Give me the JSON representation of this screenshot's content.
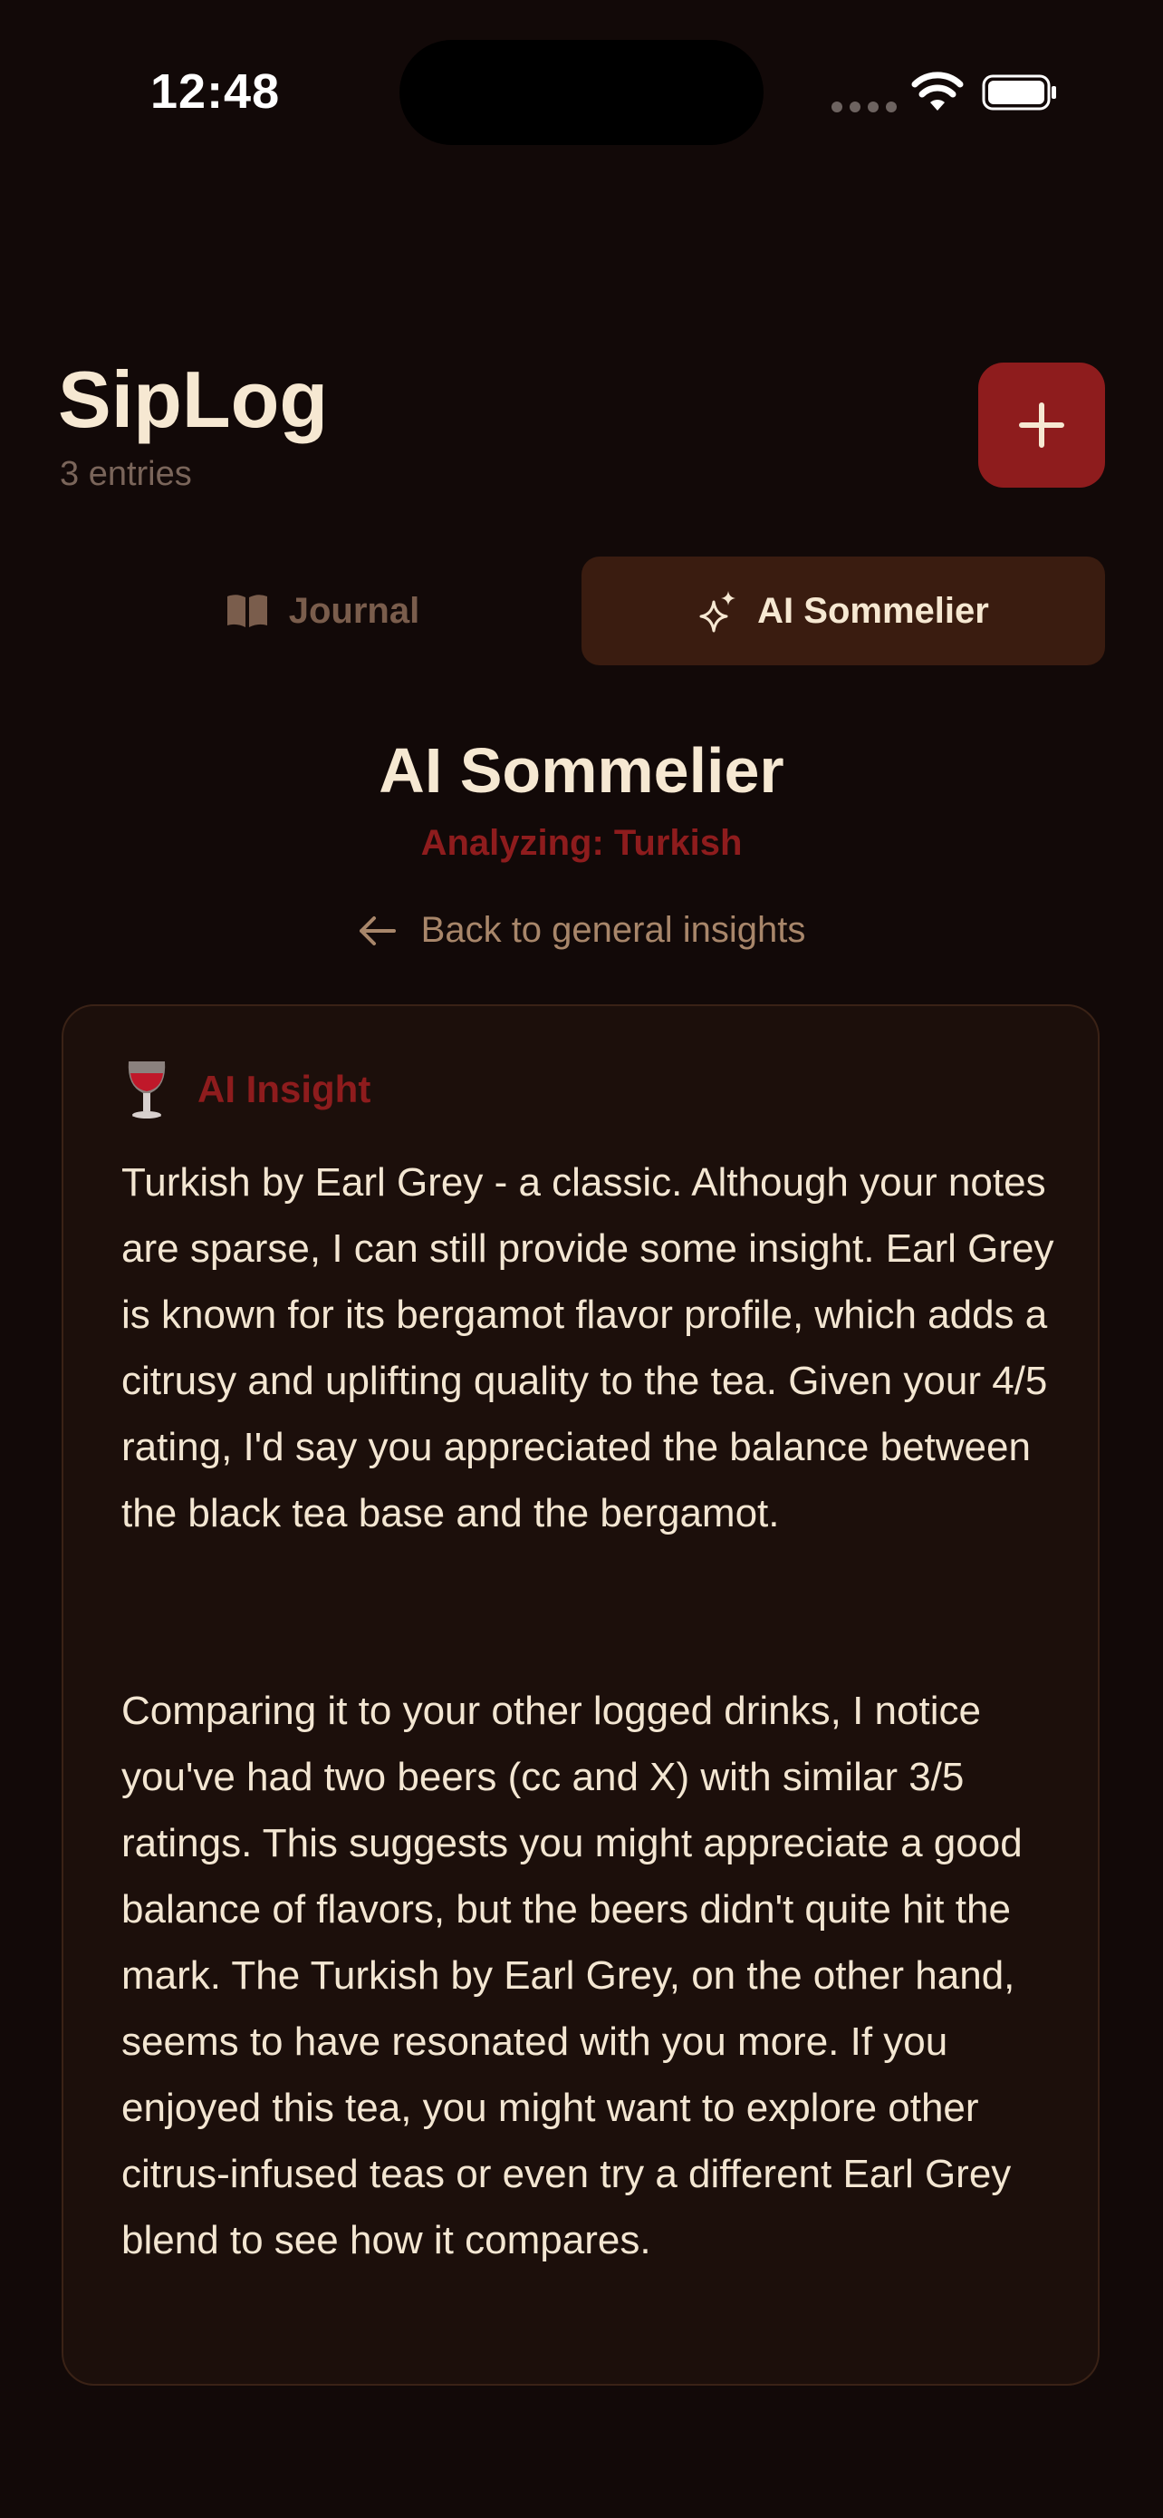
{
  "status": {
    "time": "12:48"
  },
  "header": {
    "title": "SipLog",
    "entries": "3 entries"
  },
  "tabs": {
    "journal": "Journal",
    "ai": "AI Sommelier"
  },
  "section": {
    "title": "AI Sommelier",
    "analyzing": "Analyzing: Turkish",
    "back": "Back to general insights"
  },
  "card": {
    "label": "AI Insight",
    "paragraphs": [
      "Turkish by Earl Grey - a classic. Although your notes are sparse, I can still provide some insight. Earl Grey is known for its bergamot flavor profile, which adds a citrusy and uplifting quality to the tea. Given your 4/5 rating, I'd say you appreciated the balance between the black tea base and the bergamot.",
      "Comparing it to your other logged drinks, I notice you've had two beers (cc and X) with similar 3/5 ratings. This suggests you might appreciate a good balance of flavors, but the beers didn't quite hit the mark. The Turkish by Earl Grey, on the other hand, seems to have resonated with you more. If you enjoyed this tea, you might want to explore other citrus-infused teas or even try a different Earl Grey blend to see how it compares."
    ]
  },
  "colors": {
    "background": "#120908",
    "accent": "#8e1c1d",
    "card": "#1c0f0b",
    "active_tab": "#3a1c10",
    "text": "#f3e6d2"
  },
  "icons": {
    "add": "plus-icon",
    "journal": "book-open-icon",
    "ai": "sparkles-icon",
    "back": "arrow-left-icon",
    "insight": "wine-glass-icon"
  }
}
